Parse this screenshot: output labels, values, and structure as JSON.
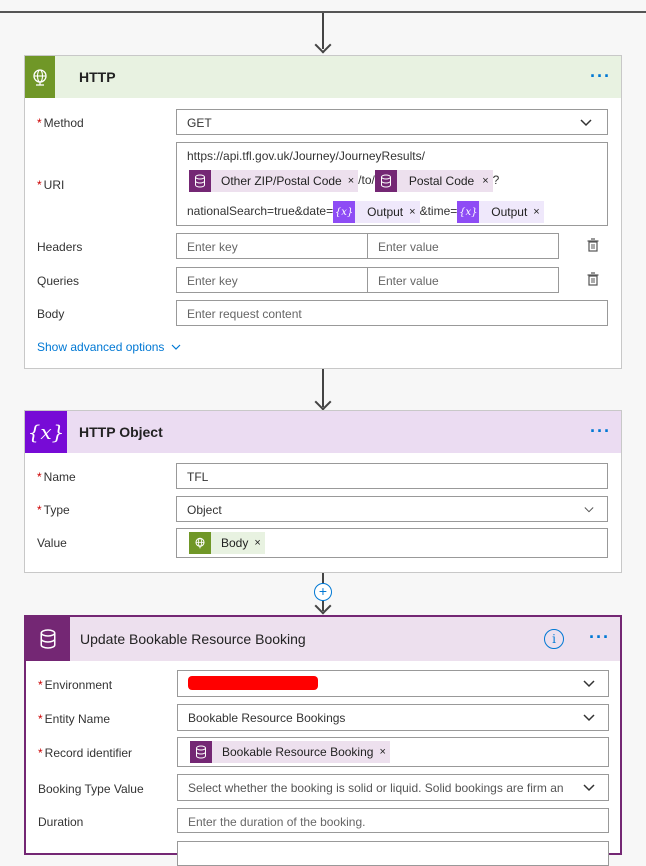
{
  "colors": {
    "http_header_bg": "#e8f2e1",
    "http_icon_bg": "#709727",
    "var_header_bg": "#ebdcf2",
    "var_icon_bg": "#770bd6",
    "cds_header_bg": "#ede0ee",
    "cds_icon_bg": "#742774",
    "var_token_bg": "#efe8fb",
    "var_token_icon": "#8e4cf5",
    "cds_token_bg": "#ede0ee",
    "http_token_bg": "#e8f2e1",
    "link": "#0078d4",
    "required": "#cc0000",
    "redaction": "#ff0000"
  },
  "http": {
    "title": "HTTP",
    "icon": "globe-icon",
    "method": {
      "label": "Method",
      "value": "GET"
    },
    "uri": {
      "label": "URI",
      "line1": "https://api.tfl.gov.uk/Journey/JourneyResults/",
      "token1": "Other ZIP/Postal Code",
      "sep1": "/to/",
      "token2": "Postal Code",
      "sep2": "?",
      "line3_prefix": "nationalSearch=true&date=",
      "token3": "Output",
      "sep3": "&time=",
      "token4": "Output"
    },
    "headers": {
      "label": "Headers",
      "key_placeholder": "Enter key",
      "value_placeholder": "Enter value"
    },
    "queries": {
      "label": "Queries",
      "key_placeholder": "Enter key",
      "value_placeholder": "Enter value"
    },
    "body": {
      "label": "Body",
      "placeholder": "Enter request content"
    },
    "advanced_link": "Show advanced options"
  },
  "http_object": {
    "title": "HTTP Object",
    "icon_text": "{x}",
    "name": {
      "label": "Name",
      "value": "TFL"
    },
    "type": {
      "label": "Type",
      "value": "Object"
    },
    "value": {
      "label": "Value",
      "token": "Body"
    }
  },
  "update": {
    "title": "Update Bookable Resource Booking",
    "environment": {
      "label": "Environment"
    },
    "entity": {
      "label": "Entity Name",
      "value": "Bookable Resource Bookings"
    },
    "record": {
      "label": "Record identifier",
      "token": "Bookable Resource Booking"
    },
    "booking_type": {
      "label": "Booking Type Value",
      "placeholder": "Select whether the booking is solid or liquid. Solid bookings are firm an"
    },
    "duration": {
      "label": "Duration",
      "placeholder": "Enter the duration of the booking."
    }
  },
  "glyphs": {
    "close": "×",
    "ellipsis": "···",
    "info": "i",
    "plus": "+"
  }
}
